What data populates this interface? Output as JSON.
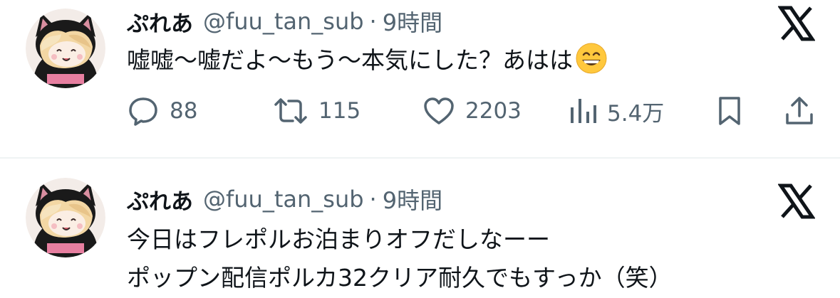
{
  "tweets": [
    {
      "author": "ぷれあ",
      "handle": "@fuu_tan_sub",
      "separator": "·",
      "time": "9時間",
      "lines": [
        "嘘嘘〜嘘だよ〜もう〜本気にした？あはは"
      ],
      "emoji": "grinning-face-with-smiling-eyes",
      "stats": {
        "replies": "88",
        "retweets": "115",
        "likes": "2203",
        "views": "5.4万"
      }
    },
    {
      "author": "ぷれあ",
      "handle": "@fuu_tan_sub",
      "separator": "·",
      "time": "9時間",
      "lines": [
        "今日はフレポルお泊まりオフだしなーー",
        "ポップン配信ポルカ32クリア耐久でもすっか（笑）"
      ]
    }
  ],
  "colors": {
    "text": "#0f1419",
    "secondary": "#536471",
    "divider": "#eff3f4",
    "background": "#ffffff"
  },
  "icons": {
    "reply": "speech-bubble-icon",
    "retweet": "retweet-arrows-icon",
    "like": "heart-icon",
    "views": "bar-chart-icon",
    "bookmark": "bookmark-icon",
    "share": "share-upload-icon",
    "brand": "x-logo-icon"
  }
}
